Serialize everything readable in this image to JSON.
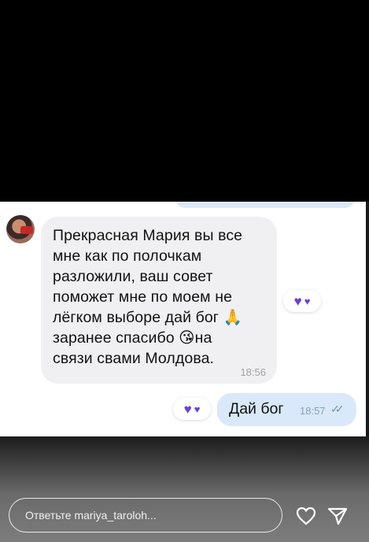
{
  "chat": {
    "incoming": {
      "text": "Прекрасная Мария вы все\nмне как по полочкам\nразложили, ваш совет\nпоможет мне по моем не\nлёгком выборе дай бог 🙏\nзаранее спасибо 😘на\nсвязи свами Молдова.",
      "time": "18:56"
    },
    "outgoing": {
      "text": "Дай бог",
      "time": "18:57"
    },
    "reaction_icon": "purple-heart-icon",
    "reaction_color": "#6d3fd8"
  },
  "reply": {
    "placeholder": "Ответьте mariya_taroloh..."
  },
  "icons": {
    "like": "heart-outline-icon",
    "send": "send-icon"
  }
}
